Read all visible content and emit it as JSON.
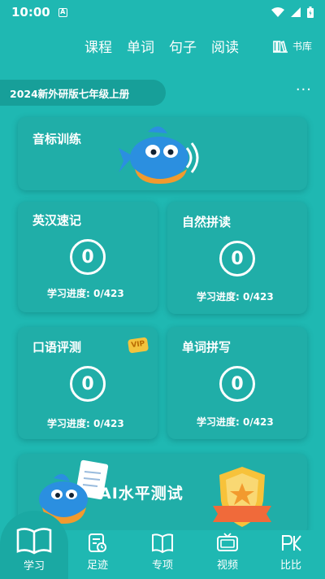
{
  "status_bar": {
    "time": "10:00",
    "notification_glyph": "A"
  },
  "top_nav": {
    "items": [
      "课程",
      "单词",
      "句子",
      "阅读"
    ],
    "library_label": "书库"
  },
  "book": {
    "title": "2024新外研版七年级上册",
    "more_glyph": "···"
  },
  "cards": {
    "phonics": {
      "title": "音标训练"
    },
    "rapid_memory": {
      "title": "英汉速记",
      "score": "0",
      "progress": "学习进度: 0/423"
    },
    "natural_phonics": {
      "title": "自然拼读",
      "score": "0",
      "progress": "学习进度: 0/423"
    },
    "oral_test": {
      "title": "口语评测",
      "badge": "VIP",
      "score": "0",
      "progress": "学习进度: 0/423"
    },
    "spelling": {
      "title": "单词拼写",
      "score": "0",
      "progress": "学习进度: 0/423"
    },
    "ai_test": {
      "title": "AI水平测试"
    }
  },
  "bottom_nav": {
    "items": [
      "学习",
      "足迹",
      "专项",
      "视频",
      "比比"
    ]
  },
  "colors": {
    "background": "#1fb8b2",
    "card": "#20aea8",
    "accent_orange": "#f29a2e",
    "fish_blue": "#2b8fe0"
  }
}
